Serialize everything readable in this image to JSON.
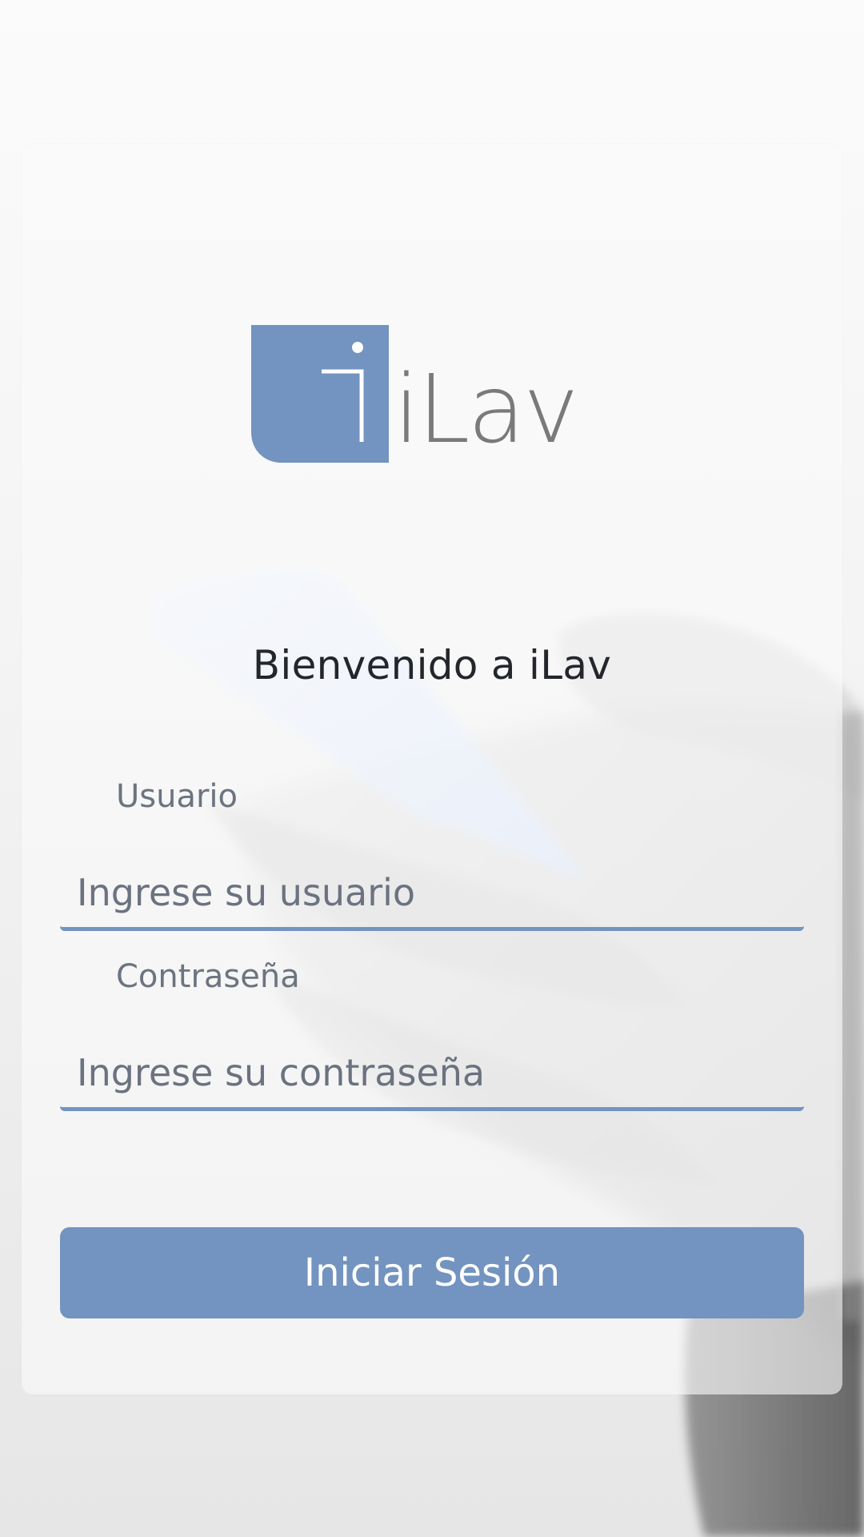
{
  "brand": {
    "logo_text": "iLav",
    "logo_icon": "ilav-logo-icon",
    "accent_color": "#7393c0",
    "logo_text_color": "#7a7a7a"
  },
  "welcome": {
    "title": "Bienvenido a iLav"
  },
  "form": {
    "username_label": "Usuario",
    "username_placeholder": "Ingrese su usuario",
    "username_value": "",
    "password_label": "Contraseña",
    "password_placeholder": "Ingrese su contraseña",
    "password_value": "",
    "submit_label": "Iniciar Sesión"
  },
  "colors": {
    "button_bg": "#7393c0",
    "button_text": "#ffffff",
    "title_text": "#23262b",
    "label_text": "#6c7480"
  }
}
